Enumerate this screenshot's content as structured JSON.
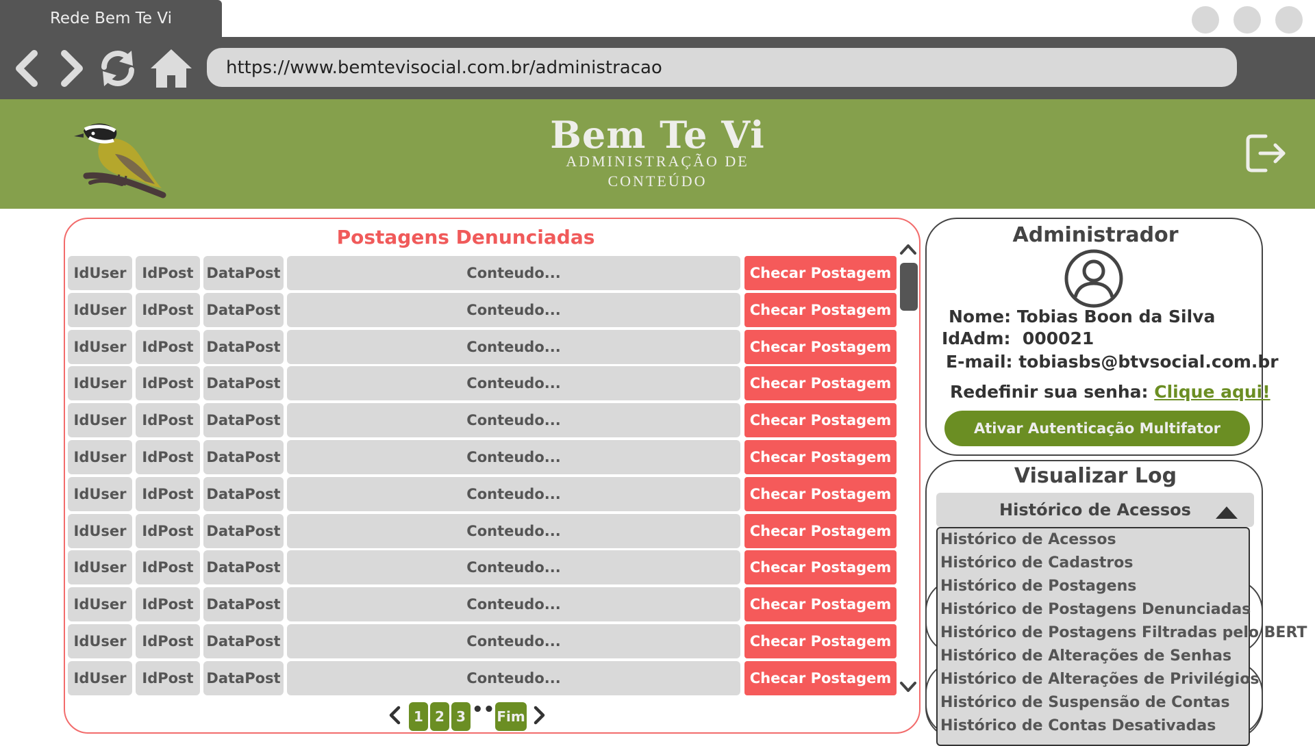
{
  "browser": {
    "tab_title": "Rede Bem Te Vi",
    "url": "https://www.bemtevisocial.com.br/administracao"
  },
  "header": {
    "brand": "Bem Te Vi",
    "subtitle_line1": "ADMINISTRAÇÃO DE",
    "subtitle_line2": "CONTEÚDO"
  },
  "reports": {
    "title": "Postagens Denunciadas",
    "rows": [
      {
        "iduser": "IdUser",
        "idpost": "IdPost",
        "datapost": "DataPost",
        "content": "Conteudo...",
        "action": "Checar Postagem"
      },
      {
        "iduser": "IdUser",
        "idpost": "IdPost",
        "datapost": "DataPost",
        "content": "Conteudo...",
        "action": "Checar Postagem"
      },
      {
        "iduser": "IdUser",
        "idpost": "IdPost",
        "datapost": "DataPost",
        "content": "Conteudo...",
        "action": "Checar Postagem"
      },
      {
        "iduser": "IdUser",
        "idpost": "IdPost",
        "datapost": "DataPost",
        "content": "Conteudo...",
        "action": "Checar Postagem"
      },
      {
        "iduser": "IdUser",
        "idpost": "IdPost",
        "datapost": "DataPost",
        "content": "Conteudo...",
        "action": "Checar Postagem"
      },
      {
        "iduser": "IdUser",
        "idpost": "IdPost",
        "datapost": "DataPost",
        "content": "Conteudo...",
        "action": "Checar Postagem"
      },
      {
        "iduser": "IdUser",
        "idpost": "IdPost",
        "datapost": "DataPost",
        "content": "Conteudo...",
        "action": "Checar Postagem"
      },
      {
        "iduser": "IdUser",
        "idpost": "IdPost",
        "datapost": "DataPost",
        "content": "Conteudo...",
        "action": "Checar Postagem"
      },
      {
        "iduser": "IdUser",
        "idpost": "IdPost",
        "datapost": "DataPost",
        "content": "Conteudo...",
        "action": "Checar Postagem"
      },
      {
        "iduser": "IdUser",
        "idpost": "IdPost",
        "datapost": "DataPost",
        "content": "Conteudo...",
        "action": "Checar Postagem"
      },
      {
        "iduser": "IdUser",
        "idpost": "IdPost",
        "datapost": "DataPost",
        "content": "Conteudo...",
        "action": "Checar Postagem"
      },
      {
        "iduser": "IdUser",
        "idpost": "IdPost",
        "datapost": "DataPost",
        "content": "Conteudo...",
        "action": "Checar Postagem"
      }
    ],
    "pagination": {
      "pages": [
        "1",
        "2",
        "3"
      ],
      "ellipsis": "•••",
      "last": "Fim"
    }
  },
  "admin": {
    "title": "Administrador",
    "name_label": "Nome:",
    "name": "Tobias Boon da Silva",
    "id_label": "IdAdm:",
    "id": "000021",
    "email_label": "E-mail:",
    "email": "tobiasbs@btvsocial.com.br",
    "reset_label": "Redefinir sua senha:",
    "reset_link": "Clique aqui!",
    "mfa_button": "Ativar Autenticação Multifator"
  },
  "log": {
    "title": "Visualizar Log",
    "selected": "Histórico de Acessos",
    "options": [
      "Histórico de Acessos",
      "Histórico de Cadastros",
      "Histórico de Postagens",
      "Histórico de Postagens Denunciadas",
      "Histórico de Postagens Filtradas pelo BERT",
      "Histórico de Alterações de Senhas",
      "Histórico de Alterações de Privilégios",
      "Histórico de Suspensão de Contas",
      "Histórico de Contas Desativadas"
    ]
  },
  "colors": {
    "header_green": "#85a04c",
    "button_green": "#6b8e23",
    "report_red": "#f55a5a",
    "chrome_gray": "#555555",
    "cell_gray": "#d9d9d9"
  }
}
